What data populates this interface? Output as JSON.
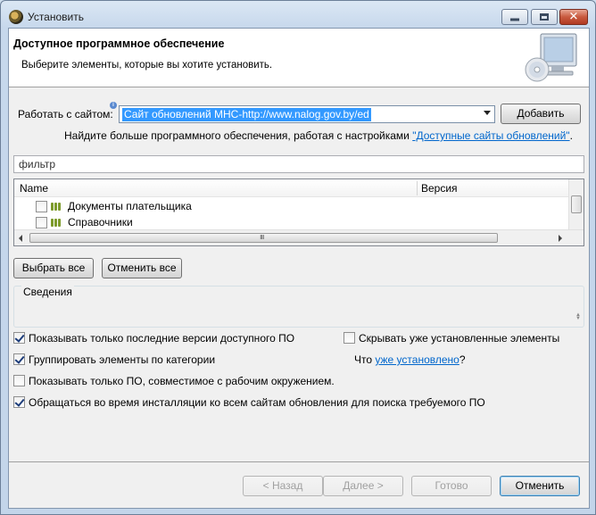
{
  "window": {
    "title": "Установить"
  },
  "banner": {
    "title": "Доступное программное обеспечение",
    "subtitle": "Выберите элементы, которые вы хотите установить."
  },
  "site": {
    "label": "Работать с сайтом:",
    "value": "Сайт обновлений МНС-http://www.nalog.gov.by/ed",
    "add_button": "Добавить",
    "more_text": "Найдите больше программного обеспечения, работая с настройками",
    "more_link": "\"Доступные сайты обновлений\"",
    "more_suffix": "."
  },
  "filter": {
    "placeholder": "фильтр"
  },
  "tree": {
    "columns": [
      "Name",
      "Версия"
    ],
    "rows": [
      {
        "label": "Документы плательщика",
        "checked": false
      },
      {
        "label": "Справочники",
        "checked": false
      }
    ]
  },
  "actions": {
    "select_all": "Выбрать все",
    "deselect_all": "Отменить все"
  },
  "details": {
    "title": "Сведения"
  },
  "options": {
    "latest_only": {
      "label": "Показывать только последние версии доступного ПО",
      "checked": true
    },
    "hide_installed": {
      "label": "Скрывать уже установленные элементы",
      "checked": false
    },
    "group_by_category": {
      "label": "Группировать элементы по категории",
      "checked": true
    },
    "compatible_only": {
      "label": "Показывать только ПО, совместимое с рабочим окружением.",
      "checked": false
    },
    "contact_all_sites": {
      "label": "Обращаться во время инсталляции ко всем сайтам обновления для поиска требуемого ПО",
      "checked": true
    },
    "what_prefix": "Что",
    "what_link": "уже установлено",
    "what_suffix": "?"
  },
  "footer": {
    "back": "< Назад",
    "next": "Далее >",
    "finish": "Готово",
    "cancel": "Отменить"
  }
}
